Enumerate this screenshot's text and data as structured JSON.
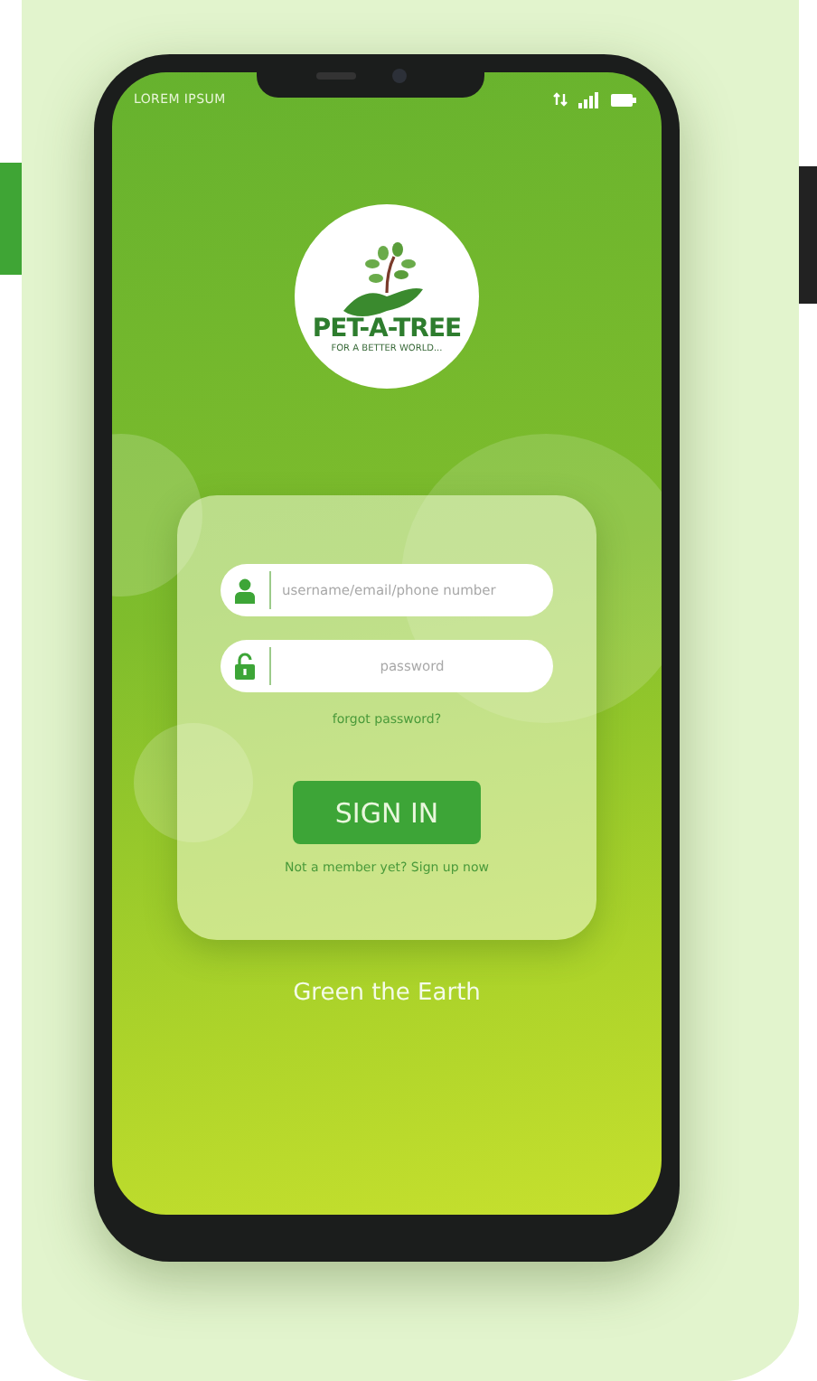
{
  "status_bar": {
    "carrier": "LOREM IPSUM"
  },
  "logo": {
    "title": "PET-A-TREE",
    "tagline": "FOR A BETTER WORLD..."
  },
  "login": {
    "username": {
      "placeholder": "username/email/phone number"
    },
    "password": {
      "placeholder": "password"
    },
    "forgot_link": "forgot password?",
    "sign_in_button": "SIGN IN",
    "signup_link": "Not a member yet? Sign up now"
  },
  "footer": {
    "tagline": "Green the Earth"
  }
}
